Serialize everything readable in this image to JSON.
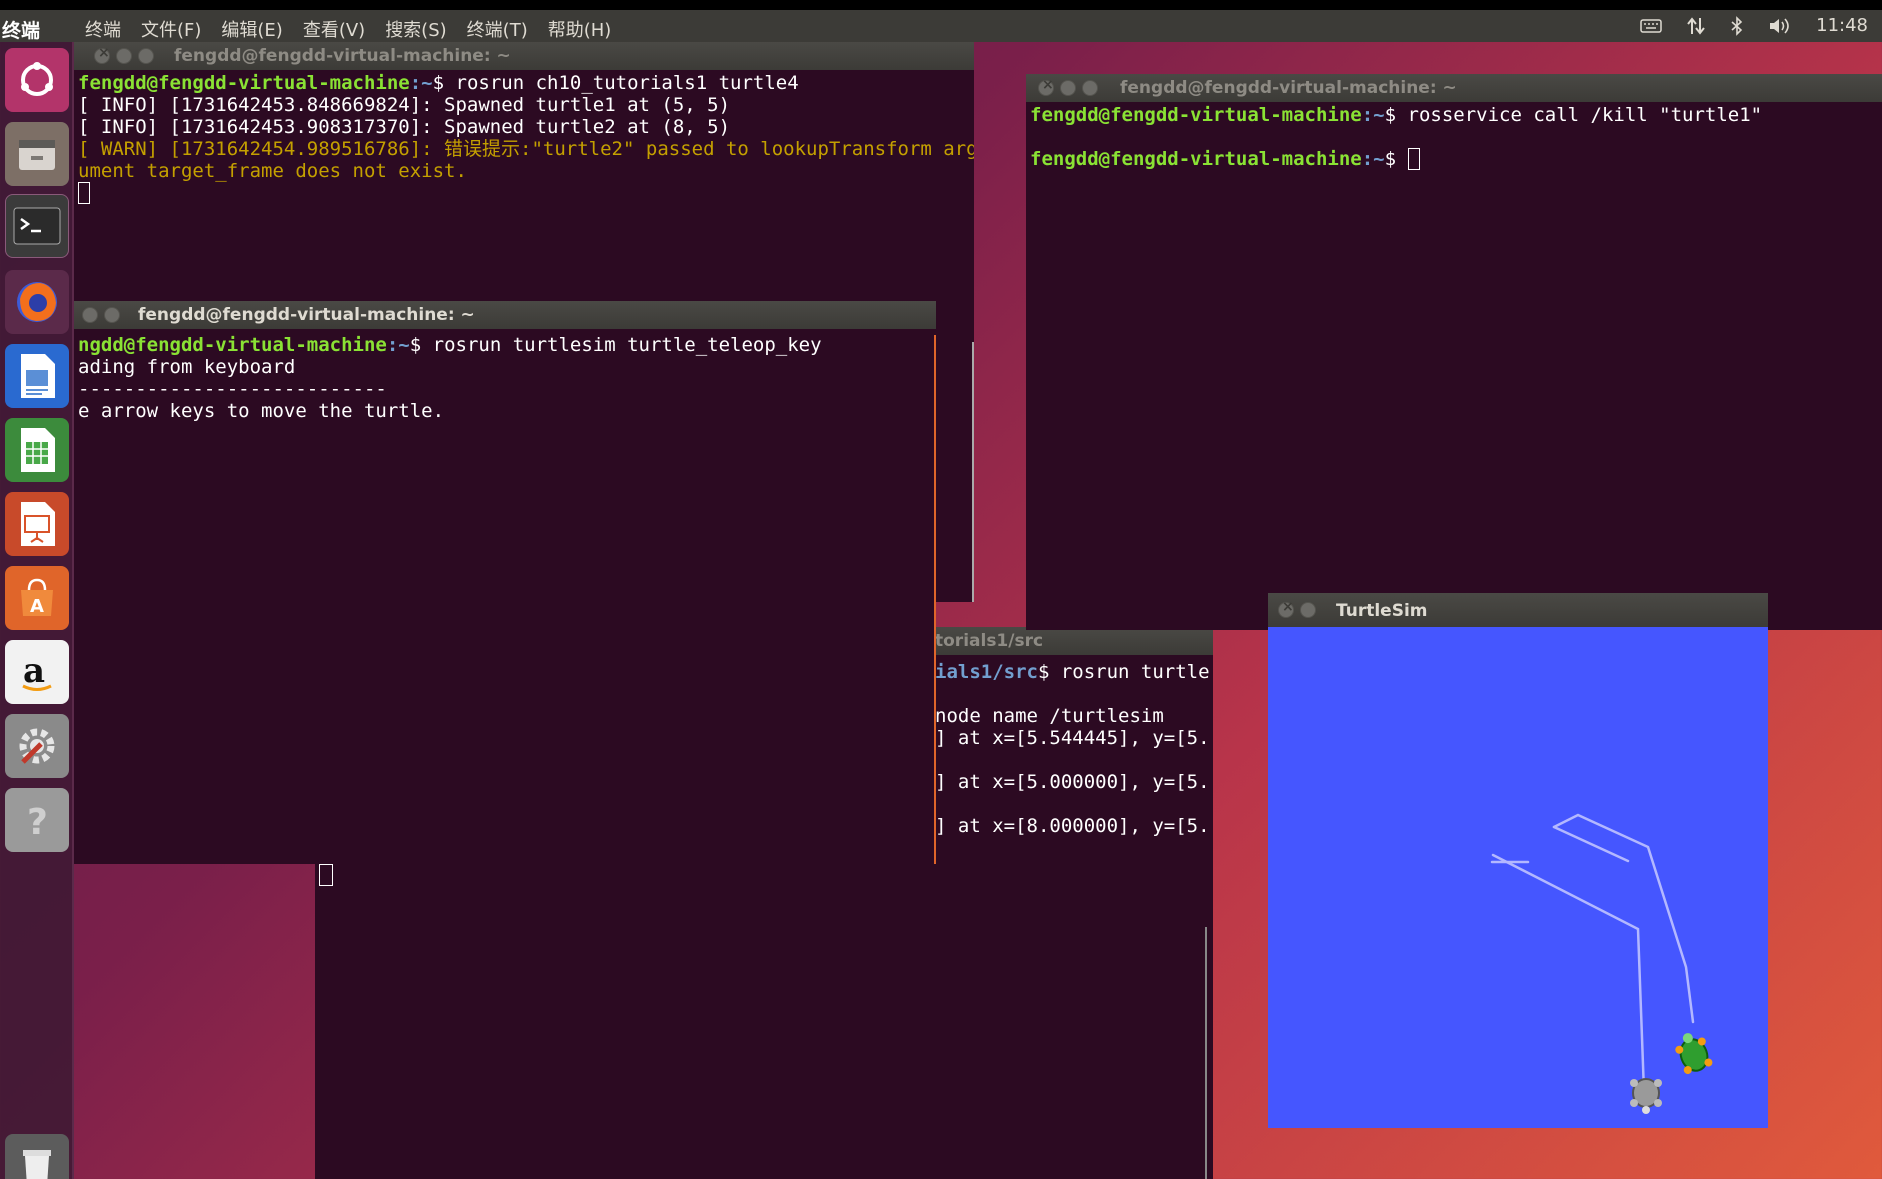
{
  "topbar": {
    "app_title": "终端",
    "menus": [
      "终端",
      "文件(F)",
      "编辑(E)",
      "查看(V)",
      "搜索(S)",
      "终端(T)",
      "帮助(H)"
    ],
    "indicators": [
      "keyboard-icon",
      "network-icon",
      "bluetooth-icon",
      "volume-icon"
    ],
    "clock": "11:48"
  },
  "launcher": {
    "items": [
      "ubuntu-home-icon",
      "files-icon",
      "terminal-icon",
      "firefox-icon",
      "writer-icon",
      "calc-icon",
      "impress-icon",
      "software-center-icon",
      "amazon-icon",
      "system-settings-icon",
      "help-icon",
      "trash-icon"
    ]
  },
  "win1": {
    "title": "fengdd@fengdd-virtual-machine: ~",
    "prompt_user": "fengdd@fengdd-virtual-machine",
    "prompt_path": ":~",
    "command": "$ rosrun ch10_tutorials1 turtle4",
    "line1": "[ INFO] [1731642453.848669824]: Spawned turtle1 at (5, 5)",
    "line2": "[ INFO] [1731642453.908317370]: Spawned turtle2 at (8, 5)",
    "warn1": "[ WARN] [1731642454.989516786]: 错误提示:\"turtle2\" passed to lookupTransform arg",
    "warn2": "ument target_frame does not exist."
  },
  "win2": {
    "title": "fengdd@fengdd-virtual-machine: ~",
    "prompt_user": "fengdd@fengdd-virtual-machine",
    "prompt_path": ":~",
    "command": "$ rosservice call /kill \"turtle1\"",
    "prompt2_user": "fengdd@fengdd-virtual-machine",
    "prompt2_path": ":~",
    "prompt2_end": "$ "
  },
  "win3": {
    "title": "fengdd@fengdd-virtual-machine: ~",
    "prompt_user": "ngdd@fengdd-virtual-machine",
    "prompt_path": ":~",
    "command": "$ rosrun turtlesim turtle_teleop_key",
    "line1": "ading from keyboard",
    "line2": "---------------------------",
    "line3": "e arrow keys to move the turtle."
  },
  "win4": {
    "title": "torials1/src",
    "prompt_path": "ials1/src",
    "command": "$ rosrun turtle",
    "line1": "node name /turtlesim",
    "line2": "] at x=[5.544445], y=[5.",
    "line3": "] at x=[5.000000], y=[5.",
    "line4": "] at x=[8.000000], y=[5."
  },
  "turtlesim": {
    "title": "TurtleSim",
    "background": "#4556ff",
    "trail_color": "#b3b8ff"
  }
}
